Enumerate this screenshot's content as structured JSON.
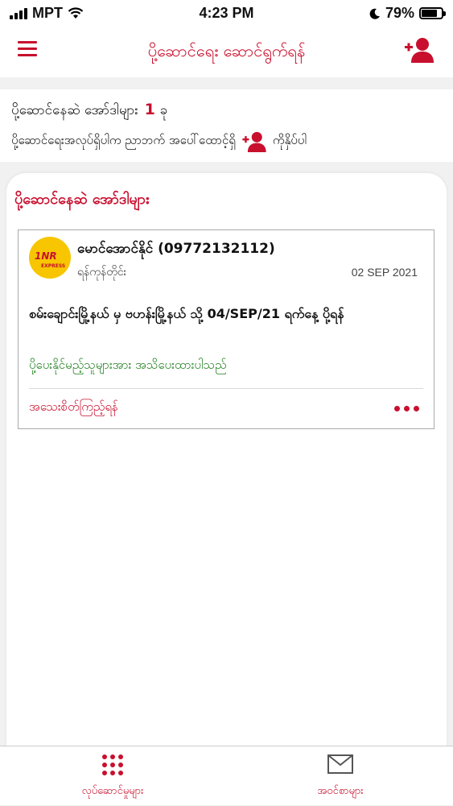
{
  "status_bar": {
    "carrier": "MPT",
    "time": "4:23 PM",
    "battery": "79%",
    "battery_level": 0.79
  },
  "header": {
    "title": "ပို့ဆောင်ရေး ဆောင်ရွက်ရန်",
    "menu_icon": "hamburger-menu-icon",
    "user_icon": "add-user-icon"
  },
  "summary": {
    "pending_label": "ပို့ဆောင်နေဆဲ အော်ဒါများ",
    "pending_count": "1",
    "pending_unit": "ခု",
    "instruction_before": "ပို့ဆောင်ရေးအလုပ်ရှိပါက ညာဘက် အပေါ်ထောင့်ရှိ",
    "instruction_after": "ကိုနှိပ်ပါ"
  },
  "panel": {
    "title": "ပို့ဆောင်နေဆဲ အော်ဒါများ"
  },
  "order": {
    "logo_text": "1NR",
    "logo_subtext": "EXPRESS",
    "sender": "မောင်အောင်နိုင် (09772132112)",
    "city": "ရန်ကုန်တိုင်း",
    "date": "02 SEP 2021",
    "route": "စမ်းချောင်းမြို့နယ် မှ ဗဟန်းမြို့နယ် သို့ 04/SEP/21 ရက်နေ့ ပို့ရန်",
    "status": "ပို့ပေးနိုင်မည့်သူများအား အသိပေးထားပါသည်",
    "details_link": "အသေးစိတ်ကြည့်ရန်"
  },
  "tabs": [
    {
      "label": "လုပ်ဆောင်မှုများ",
      "icon": "grid-icon"
    },
    {
      "label": "အဝင်စာများ",
      "icon": "mail-icon"
    }
  ],
  "colors": {
    "brand_red": "#c8102e",
    "status_green": "#1e7f1e",
    "logo_yellow": "#f7c600"
  }
}
